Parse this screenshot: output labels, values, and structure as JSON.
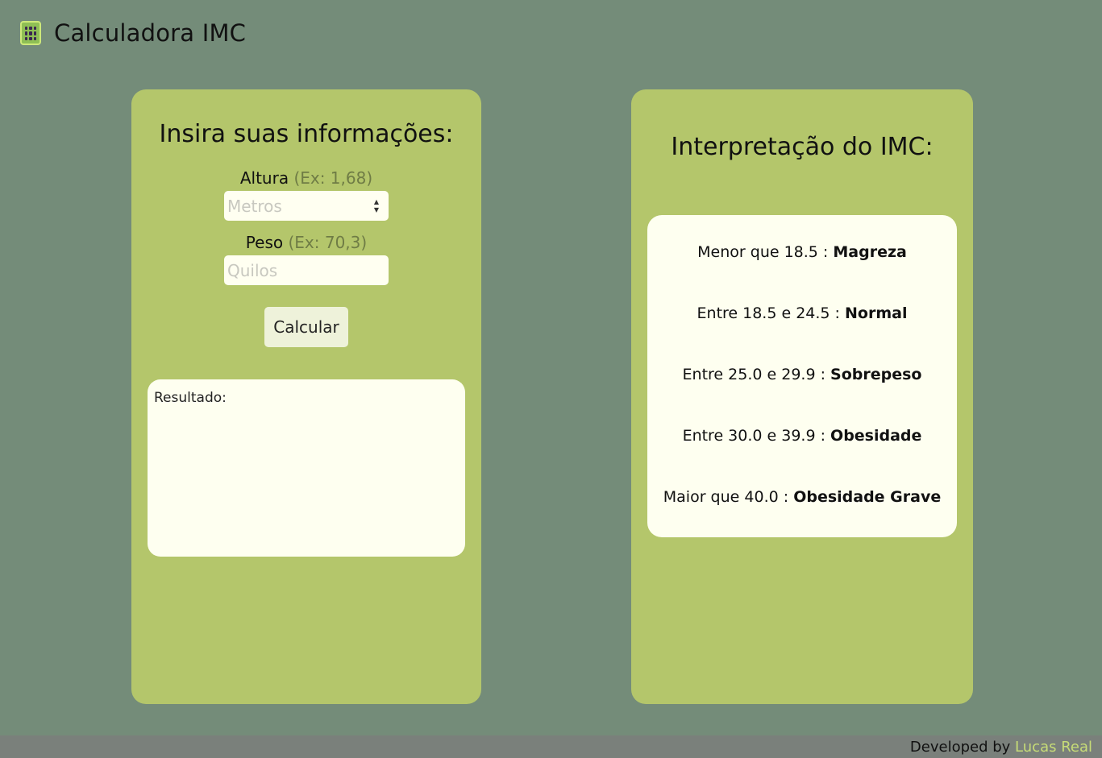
{
  "header": {
    "logo_icon": "calculator-icon",
    "title": "Calculadora IMC"
  },
  "form": {
    "title": "Insira suas informações:",
    "altura_label": "Altura",
    "altura_hint": "(Ex: 1,68)",
    "altura_placeholder": "Metros",
    "altura_value": "",
    "peso_label": "Peso",
    "peso_hint": "(Ex: 70,3)",
    "peso_placeholder": "Quilos",
    "peso_value": "",
    "button_label": "Calcular",
    "result_label": "Resultado:"
  },
  "interpretation": {
    "title": "Interpretação do IMC:",
    "ranges": [
      {
        "text": "Menor que 18.5 : ",
        "category": "Magreza"
      },
      {
        "text": "Entre 18.5 e 24.5 : ",
        "category": "Normal"
      },
      {
        "text": "Entre 25.0 e 29.9 : ",
        "category": "Sobrepeso"
      },
      {
        "text": "Entre 30.0 e 39.9 : ",
        "category": "Obesidade"
      },
      {
        "text": "Maior que 40.0 : ",
        "category": "Obesidade Grave"
      }
    ]
  },
  "footer": {
    "prefix": "Developed by ",
    "author": "Lucas Real"
  },
  "colors": {
    "background": "#748c79",
    "panel": "#b4c66b",
    "box": "#fefff0",
    "accent_link": "#c7dc77"
  }
}
